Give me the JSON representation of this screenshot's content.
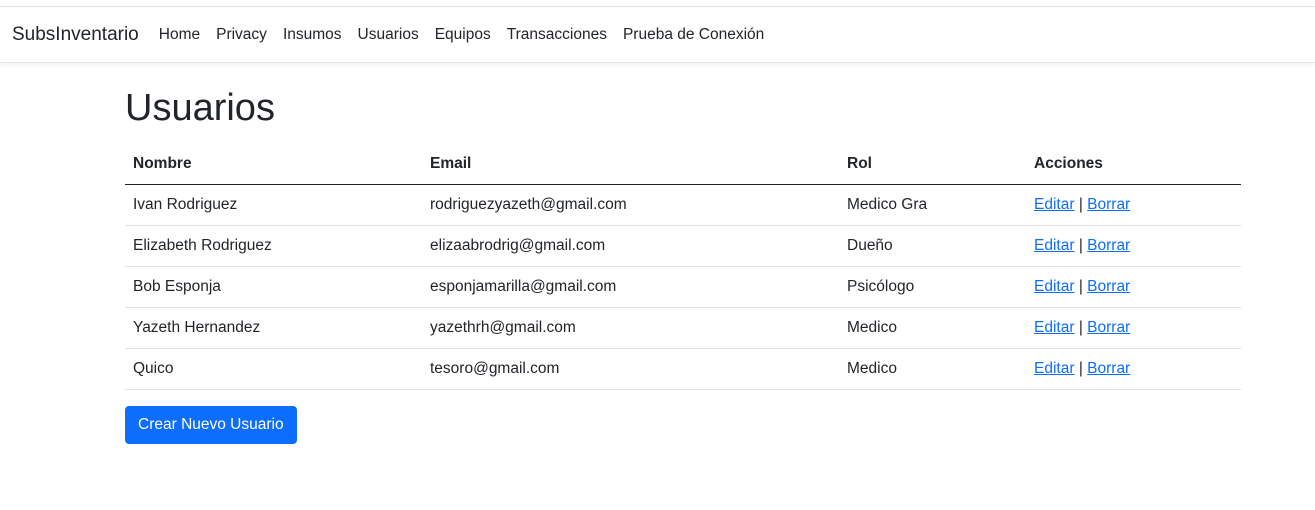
{
  "navbar": {
    "brand": "SubsInventario",
    "links": [
      "Home",
      "Privacy",
      "Insumos",
      "Usuarios",
      "Equipos",
      "Transacciones",
      "Prueba de Conexión"
    ]
  },
  "page": {
    "title": "Usuarios"
  },
  "table": {
    "headers": [
      "Nombre",
      "Email",
      "Rol",
      "Acciones"
    ],
    "rows": [
      {
        "nombre": "Ivan Rodriguez",
        "email": "rodriguezyazeth@gmail.com",
        "rol": "Medico Gra"
      },
      {
        "nombre": "Elizabeth Rodriguez",
        "email": "elizaabrodrig@gmail.com",
        "rol": "Dueño"
      },
      {
        "nombre": "Bob Esponja",
        "email": "esponjamarilla@gmail.com",
        "rol": "Psicólogo"
      },
      {
        "nombre": "Yazeth Hernandez",
        "email": "yazethrh@gmail.com",
        "rol": "Medico"
      },
      {
        "nombre": "Quico",
        "email": "tesoro@gmail.com",
        "rol": "Medico"
      }
    ],
    "actions": {
      "edit_label": "Editar",
      "separator": "|",
      "delete_label": "Borrar"
    }
  },
  "create_button": {
    "label": "Crear Nuevo Usuario"
  },
  "colors": {
    "link": "#0d6efd",
    "primary_button": "#0d6efd",
    "text": "#212529"
  }
}
